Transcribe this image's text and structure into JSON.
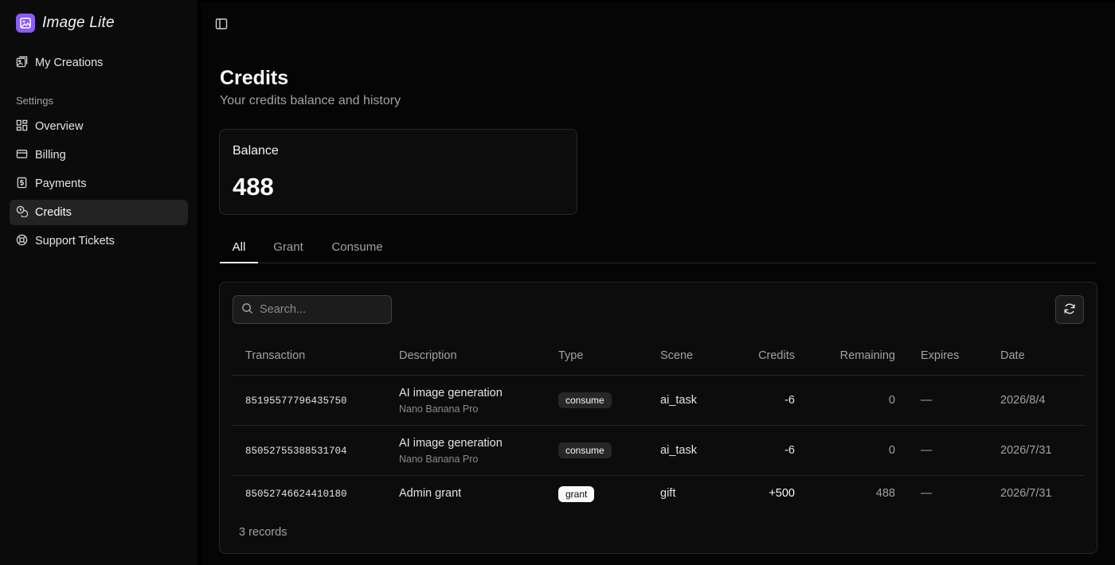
{
  "app": {
    "name": "Image Lite"
  },
  "sidebar": {
    "top_item": {
      "label": "My Creations",
      "icon": "image-icon"
    },
    "group_label": "Settings",
    "items": [
      {
        "label": "Overview",
        "icon": "grid-icon"
      },
      {
        "label": "Billing",
        "icon": "credit-card-icon"
      },
      {
        "label": "Payments",
        "icon": "receipt-dollar-icon"
      },
      {
        "label": "Credits",
        "icon": "coins-icon",
        "active": true
      },
      {
        "label": "Support Tickets",
        "icon": "lifebuoy-icon"
      }
    ]
  },
  "page": {
    "title": "Credits",
    "subtitle": "Your credits balance and history"
  },
  "balance": {
    "label": "Balance",
    "value": "488"
  },
  "tabs": [
    {
      "label": "All",
      "active": true
    },
    {
      "label": "Grant"
    },
    {
      "label": "Consume"
    }
  ],
  "table": {
    "search_placeholder": "Search...",
    "columns": [
      "Transaction",
      "Description",
      "Type",
      "Scene",
      "Credits",
      "Remaining",
      "Expires",
      "Date"
    ],
    "rows": [
      {
        "transaction": "85195577796435750",
        "description": "AI image generation",
        "description_sub": "Nano Banana Pro",
        "type": "consume",
        "scene": "ai_task",
        "credits": "-6",
        "remaining": "0",
        "expires": "—",
        "date": "2026/8/4"
      },
      {
        "transaction": "85052755388531704",
        "description": "AI image generation",
        "description_sub": "Nano Banana Pro",
        "type": "consume",
        "scene": "ai_task",
        "credits": "-6",
        "remaining": "0",
        "expires": "—",
        "date": "2026/7/31"
      },
      {
        "transaction": "85052746624410180",
        "description": "Admin grant",
        "description_sub": "",
        "type": "grant",
        "scene": "gift",
        "credits": "+500",
        "remaining": "488",
        "expires": "—",
        "date": "2026/7/31"
      }
    ],
    "records_label": "3 records"
  },
  "colors": {
    "accent": "#8b5cf6",
    "background": "#000000",
    "active_item": "#232323"
  }
}
